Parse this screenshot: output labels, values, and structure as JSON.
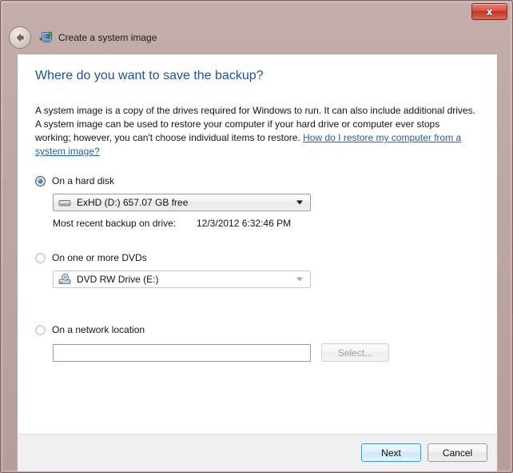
{
  "window": {
    "title": "Create a system image",
    "titlebar_icon": "system-image-computer-icon",
    "back_button_icon": "back-arrow-icon",
    "close_button_label": "x",
    "accent_color": "#1c53a6",
    "titlebar_color": "#b59d9a",
    "close_button_color": "#c03423"
  },
  "page": {
    "heading": "Where do you want to save the backup?",
    "description_part1": "A system image is a copy of the drives required for Windows to run. It can also include additional drives. A system image can be used to restore your computer if your hard drive or computer ever stops working; however, you can't choose individual items to restore. ",
    "link_text": "How do I restore my computer from a system image?"
  },
  "options": {
    "hard_disk": {
      "label": "On a hard disk",
      "selected": true,
      "combo": {
        "value": "ExHD (D:)  657.07 GB free",
        "icon": "hard-disk-icon",
        "enabled": true
      },
      "recent_backup_label": "Most recent backup on drive:",
      "recent_backup_value": "12/3/2012 6:32:46 PM"
    },
    "dvd": {
      "label": "On one or more DVDs",
      "selected": false,
      "combo": {
        "value": "DVD RW Drive (E:)",
        "icon": "dvd-drive-icon",
        "enabled": false
      }
    },
    "network": {
      "label": "On a network location",
      "selected": false,
      "input_value": "",
      "input_placeholder": "",
      "select_button_label": "Select...",
      "select_button_enabled": false
    }
  },
  "footer": {
    "next_label": "Next",
    "cancel_label": "Cancel"
  }
}
